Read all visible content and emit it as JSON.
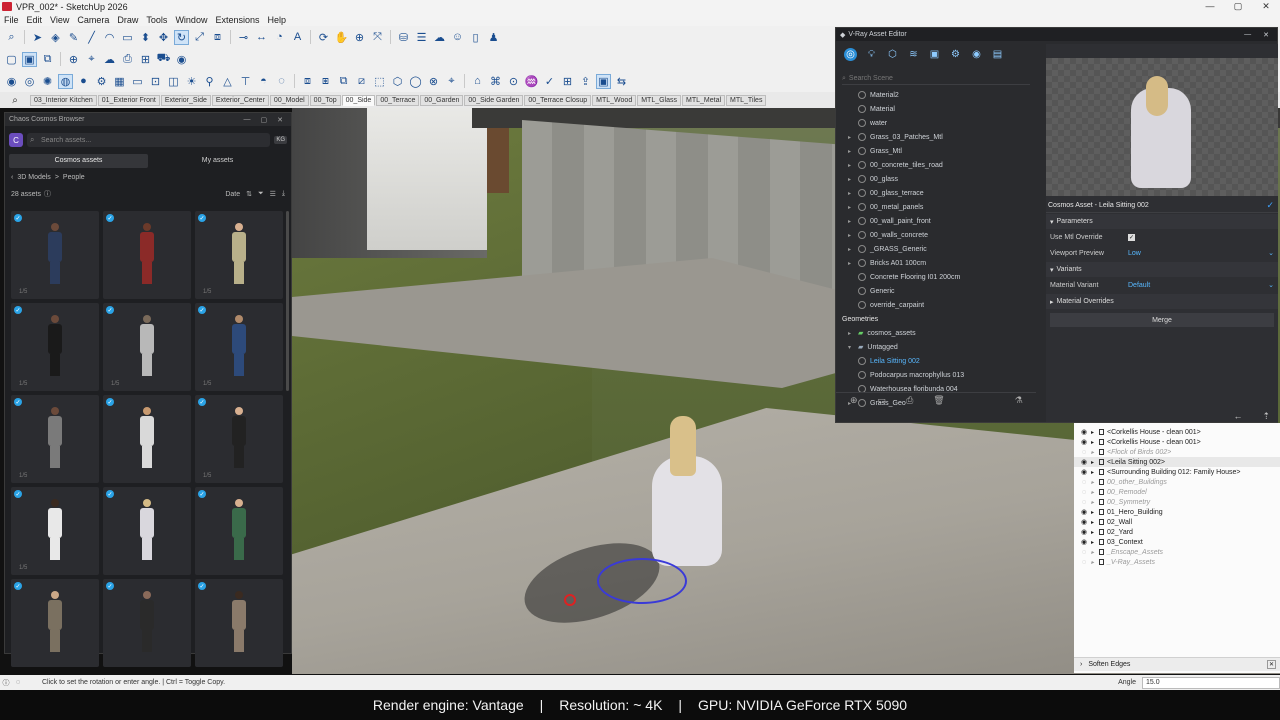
{
  "window": {
    "title": "VPR_002* - SketchUp 2026",
    "controls": [
      "—",
      "▢",
      "✕"
    ]
  },
  "menu": [
    "File",
    "Edit",
    "View",
    "Camera",
    "Draw",
    "Tools",
    "Window",
    "Extensions",
    "Help"
  ],
  "scenes": [
    "03_Interior Kitchen",
    "01_Exterior Front",
    "Exterior_Side",
    "Exterior_Center",
    "00_Model",
    "00_Top",
    "00_Side",
    "00_Terrace",
    "00_Garden",
    "00_Side Garden",
    "00_Terrace Closup",
    "MTL_Wood",
    "MTL_Glass",
    "MTL_Metal",
    "MTL_Tiles"
  ],
  "active_scene": "00_Side",
  "cosmos": {
    "title": "Chaos Cosmos Browser",
    "search_placeholder": "Search assets...",
    "kg_label": "KG",
    "tabs": [
      "Cosmos assets",
      "My assets"
    ],
    "breadcrumb": [
      "3D Models",
      ">",
      "People"
    ],
    "count": "28 assets",
    "sort": "Date",
    "cards": [
      {
        "count": "1/5",
        "color": "#2c3c5c",
        "head": "#6b4a3a"
      },
      {
        "count": "",
        "color": "#8b2a28",
        "head": "#6b3a2a"
      },
      {
        "count": "1/5",
        "color": "#b8b08a",
        "head": "#d8b090"
      },
      {
        "count": "1/5",
        "color": "#1a1a1a",
        "head": "#6b4a3a"
      },
      {
        "count": "1/5",
        "color": "#b8b8b8",
        "head": "#7a6a5a"
      },
      {
        "count": "1/5",
        "color": "#2d4a7a",
        "head": "#b08a6a"
      },
      {
        "count": "1/5",
        "color": "#7a7a7a",
        "head": "#6b4a3a"
      },
      {
        "count": "",
        "color": "#d9d9d9",
        "head": "#c89a70"
      },
      {
        "count": "1/5",
        "color": "#222",
        "head": "#d8b090"
      },
      {
        "count": "1/5",
        "color": "#e8e8e8",
        "head": "#3a2a20"
      },
      {
        "count": "",
        "color": "#d9d7dd",
        "head": "#d5bb86"
      },
      {
        "count": "",
        "color": "#3a6a4a",
        "head": "#d8b090"
      },
      {
        "count": "",
        "color": "#7a7060",
        "head": "#caa888"
      },
      {
        "count": "",
        "color": "#2a2a2a",
        "head": "#8a6a5a"
      },
      {
        "count": "",
        "color": "#8a7a6a",
        "head": "#3a2a20"
      }
    ]
  },
  "vray": {
    "title": "V-Ray Asset Editor",
    "search_placeholder": "Search Scene",
    "materials": [
      "Material2",
      "Material",
      "water",
      "Grass_03_Patches_Mtl",
      "Grass_Mtl",
      "00_concrete_tiles_road",
      "00_glass",
      "00_glass_terrace",
      "00_metal_panels",
      "00_wall_paint_front",
      "00_walls_concrete",
      "_GRASS_Generic",
      "Bricks A01 100cm",
      "Concrete Flooring I01 200cm",
      "Generic",
      "override_carpaint"
    ],
    "geometries_label": "Geometries",
    "geo_groups": [
      "cosmos_assets",
      "Untagged"
    ],
    "geo_items": [
      "Leila Sitting 002",
      "Podocarpus macrophyllus 013",
      "Waterhousea floribunda 004",
      "Grass_Geo"
    ],
    "selected_asset": "Leila Sitting 002",
    "props": {
      "header": "Cosmos Asset - Leila Sitting 002",
      "parameters": "Parameters",
      "use_mtl_override": "Use Mtl Override",
      "viewport_preview": "Viewport Preview",
      "viewport_preview_value": "Low",
      "variants": "Variants",
      "material_variant": "Material Variant",
      "material_variant_value": "Default",
      "material_overrides": "Material Overrides",
      "merge": "Merge"
    }
  },
  "outliner": [
    {
      "label": "<Corkellis House - clean 001>",
      "hidden": false
    },
    {
      "label": "<Corkellis House - clean 001>",
      "hidden": false
    },
    {
      "label": "<Flock of Birds 002>",
      "hidden": true
    },
    {
      "label": "<Leila Sitting 002>",
      "hidden": false,
      "selected": true
    },
    {
      "label": "<Surrounding Building 012: Family House>",
      "hidden": false
    },
    {
      "label": "00_other_Buildings",
      "hidden": true
    },
    {
      "label": "00_Remodel",
      "hidden": true
    },
    {
      "label": "00_Symmetry",
      "hidden": true
    },
    {
      "label": "01_Hero_Building",
      "hidden": false
    },
    {
      "label": "02_Wall",
      "hidden": false
    },
    {
      "label": "02_Yard",
      "hidden": false
    },
    {
      "label": "03_Context",
      "hidden": false
    },
    {
      "label": "_Enscape_Assets",
      "hidden": true
    },
    {
      "label": "_V-Ray_Assets",
      "hidden": true
    }
  ],
  "soften": "Soften Edges",
  "status": {
    "message": "Click to set the rotation or enter angle.  |  Ctrl = Toggle Copy.",
    "vcb_label": "Angle",
    "vcb_value": "15.0"
  },
  "caption": {
    "engine": "Render engine: Vantage",
    "resolution": "Resolution: ~ 4K",
    "gpu": "GPU: NVIDIA GeForce RTX 5090",
    "sep": "|"
  }
}
